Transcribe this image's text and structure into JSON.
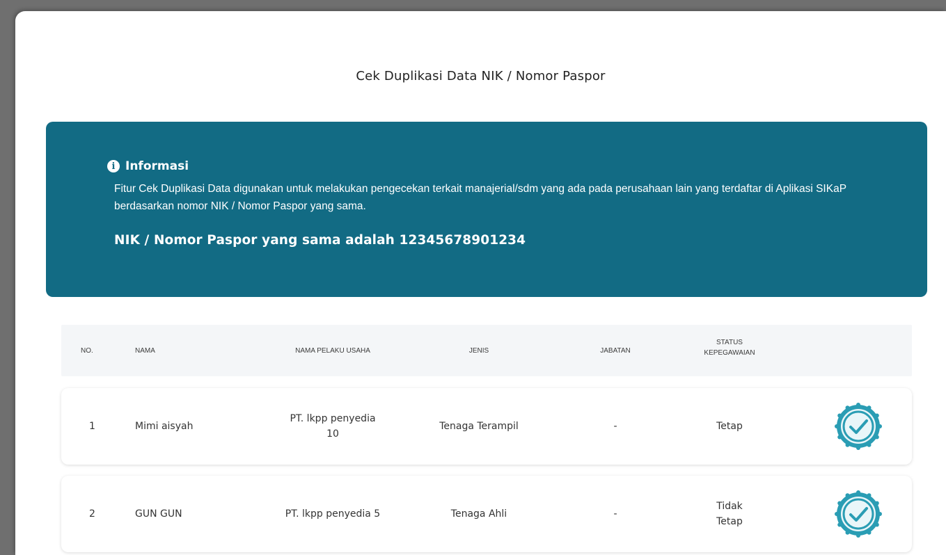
{
  "modal": {
    "title": "Cek Duplikasi Data NIK / Nomor Paspor"
  },
  "info": {
    "icon": "info-circle-icon",
    "heading": "Informasi",
    "text": "Fitur Cek Duplikasi Data digunakan untuk melakukan pengecekan terkait manajerial/sdm yang ada pada perusahaan lain yang terdaftar di Aplikasi SIKaP berdasarkan nomor NIK / Nomor Paspor yang sama.",
    "nik_line": "NIK / Nomor Paspor yang sama adalah 12345678901234",
    "background_color": "#126b84"
  },
  "table": {
    "headers": {
      "no": "NO.",
      "nama": "NAMA",
      "nama_pelaku_usaha": "NAMA PELAKU USAHA",
      "jenis": "JENIS",
      "jabatan": "JABATAN",
      "status_1": "STATUS",
      "status_2": "KEPEGAWAIAN"
    },
    "rows": [
      {
        "no": "1",
        "nama": "Mimi aisyah",
        "pelaku_1": "PT. lkpp penyedia",
        "pelaku_2": "10",
        "jenis": "Tenaga Terampil",
        "jabatan": "-",
        "status_1": "Tetap",
        "status_2": "",
        "action_icon": "check-badge-icon"
      },
      {
        "no": "2",
        "nama": "GUN GUN",
        "pelaku_1": "PT. lkpp penyedia 5",
        "pelaku_2": "",
        "jenis": "Tenaga Ahli",
        "jabatan": "-",
        "status_1": "Tidak",
        "status_2": "Tetap",
        "action_icon": "check-badge-icon"
      }
    ],
    "accent_color": "#2a9db4"
  }
}
